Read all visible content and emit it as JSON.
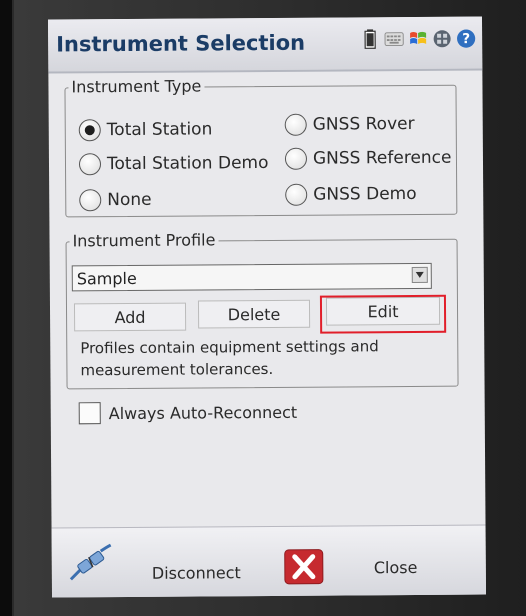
{
  "window": {
    "title": "Instrument Selection"
  },
  "status_icons": [
    "battery-icon",
    "keyboard-icon",
    "windows-flag-icon",
    "network-icon",
    "help-icon"
  ],
  "instrument_type": {
    "legend": "Instrument Type",
    "options": [
      {
        "label": "Total Station",
        "selected": true
      },
      {
        "label": "Total Station Demo",
        "selected": false
      },
      {
        "label": "None",
        "selected": false
      },
      {
        "label": "GNSS Rover",
        "selected": false
      },
      {
        "label": "GNSS Reference",
        "selected": false
      },
      {
        "label": "GNSS Demo",
        "selected": false
      }
    ]
  },
  "instrument_profile": {
    "legend": "Instrument Profile",
    "selected_profile": "Sample",
    "buttons": {
      "add": "Add",
      "delete": "Delete",
      "edit": "Edit"
    },
    "info": "Profiles contain equipment settings and measurement tolerances."
  },
  "auto_reconnect": {
    "label": "Always Auto-Reconnect",
    "checked": false
  },
  "bottom_bar": {
    "disconnect_label": "Disconnect",
    "close_label": "Close"
  },
  "colors": {
    "title": "#1b3c66",
    "highlight": "#e11e2a",
    "close_icon": "#c62a2f"
  }
}
